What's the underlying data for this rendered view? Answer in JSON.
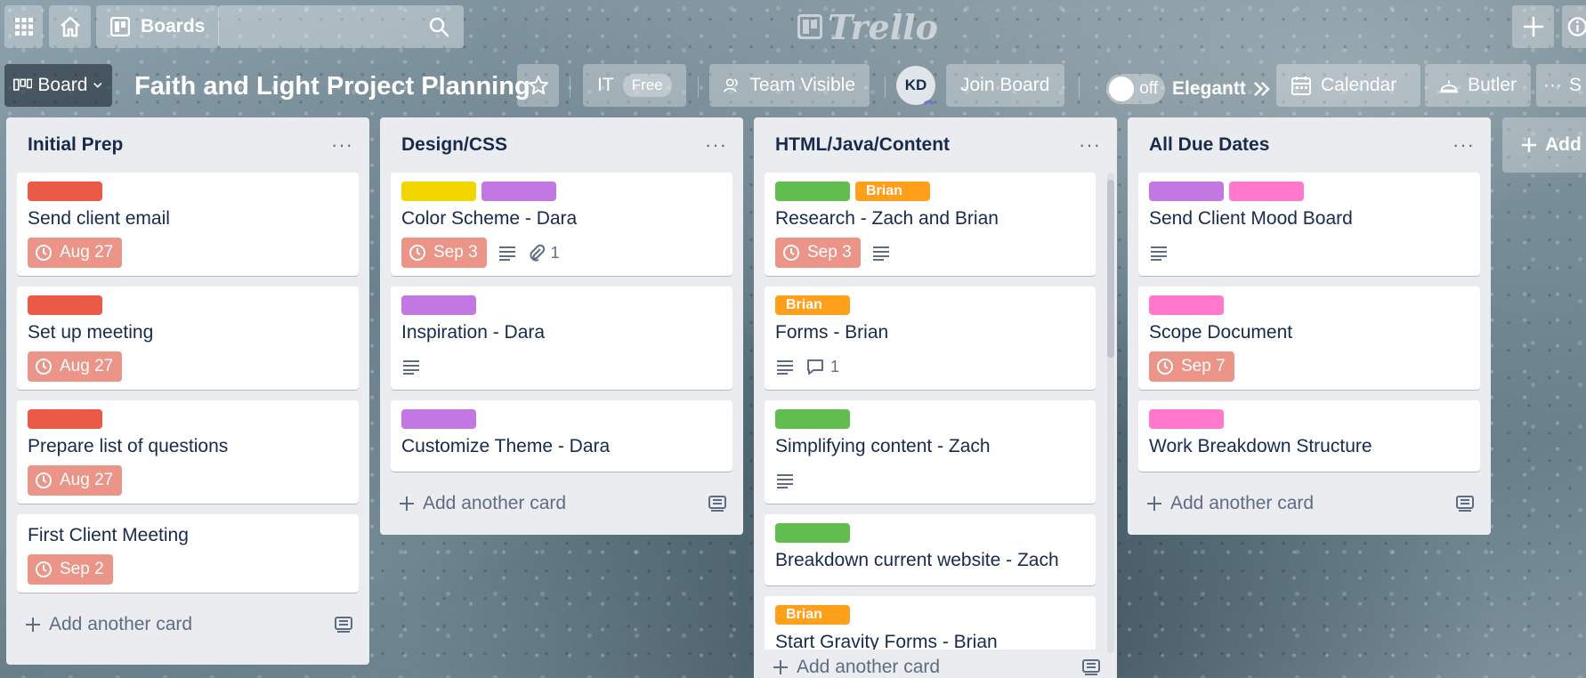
{
  "topbar": {
    "boards_label": "Boards",
    "search_placeholder": "",
    "logo_text": "Trello"
  },
  "board": {
    "view_label": "Board",
    "title": "Faith and Light Project Planning",
    "team_name": "IT",
    "team_plan": "Free",
    "visibility_label": "Team Visible",
    "member_initials": "KD",
    "join_label": "Join Board",
    "toggle_state": "off",
    "powerup_label": "Elegantt",
    "calendar_label": "Calendar",
    "butler_label": "Butler",
    "menu_partial": "S",
    "add_list_label": "Add"
  },
  "colors": {
    "red": "#eb5a46",
    "yellow": "#f2d600",
    "purple": "#c377e0",
    "green": "#61bd4f",
    "orange": "#ff9f1a",
    "pink": "#ff78cb",
    "due_bg": "#ec9488"
  },
  "add_card_label": "Add another card",
  "lists": [
    {
      "title": "Initial Prep",
      "cards": [
        {
          "title": "Send client email",
          "due": "Aug 27"
        },
        {
          "title": "Set up meeting",
          "due": "Aug 27"
        },
        {
          "title": "Prepare list of questions",
          "due": "Aug 27"
        },
        {
          "title": "First Client Meeting",
          "due": "Sep 2"
        }
      ]
    },
    {
      "title": "Design/CSS",
      "cards": [
        {
          "title": "Color Scheme - Dara",
          "due": "Sep 3",
          "attachments": "1"
        },
        {
          "title": "Inspiration - Dara"
        },
        {
          "title": "Customize Theme - Dara"
        }
      ]
    },
    {
      "title": "HTML/Java/Content",
      "cards": [
        {
          "title": "Research - Zach and Brian",
          "label_text": "Brian",
          "due": "Sep 3"
        },
        {
          "title": "Forms - Brian",
          "label_text": "Brian",
          "comments": "1"
        },
        {
          "title": "Simplifying content - Zach"
        },
        {
          "title": "Breakdown current website - Zach"
        },
        {
          "title": "Start Gravity Forms - Brian",
          "label_text": "Brian"
        }
      ]
    },
    {
      "title": "All Due Dates",
      "cards": [
        {
          "title": "Send Client Mood Board"
        },
        {
          "title": "Scope Document",
          "due": "Sep 7"
        },
        {
          "title": "Work Breakdown Structure"
        }
      ]
    }
  ]
}
